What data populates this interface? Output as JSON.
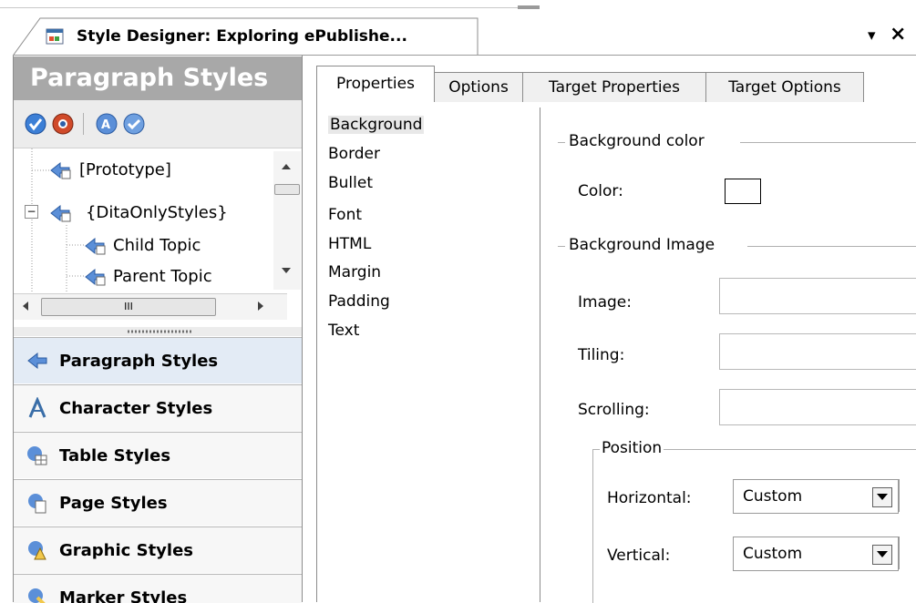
{
  "window": {
    "title": "Style Designer: Exploring ePublishe...",
    "pin_glyph": "▾",
    "close_glyph": "×"
  },
  "left_panel": {
    "header": "Paragraph Styles",
    "toolbar_icons": [
      "check-icon",
      "delete-style-icon",
      "rename-style-icon",
      "apply-style-icon"
    ],
    "tree": [
      {
        "label": "[Prototype]",
        "icon": "paragraph-style-icon"
      },
      {
        "label": "{DitaOnlyStyles}",
        "icon": "paragraph-style-icon",
        "expander": "⊟"
      },
      {
        "label": "Child Topic",
        "icon": "paragraph-style-icon"
      },
      {
        "label": "Parent Topic",
        "icon": "paragraph-style-icon"
      }
    ],
    "hscroll_grip": "III",
    "nav": [
      {
        "label": "Paragraph Styles",
        "icon": "paragraph-styles-icon",
        "selected": true
      },
      {
        "label": "Character Styles",
        "icon": "character-styles-icon"
      },
      {
        "label": "Table Styles",
        "icon": "table-styles-icon"
      },
      {
        "label": "Page Styles",
        "icon": "page-styles-icon"
      },
      {
        "label": "Graphic Styles",
        "icon": "graphic-styles-icon"
      },
      {
        "label": "Marker Styles",
        "icon": "marker-styles-icon"
      }
    ]
  },
  "tabs": [
    "Properties",
    "Options",
    "Target Properties",
    "Target Options"
  ],
  "property_list": [
    "Background",
    "Border",
    "Bullet",
    "Font",
    "HTML",
    "Margin",
    "Padding",
    "Text"
  ],
  "background_color": {
    "group": "Background color",
    "color_label": "Color:",
    "color_value": "#ffffff"
  },
  "background_image": {
    "group": "Background Image",
    "image_label": "Image:",
    "tiling_label": "Tiling:",
    "scrolling_label": "Scrolling:",
    "position_group": "Position",
    "horizontal_label": "Horizontal:",
    "horizontal_value": "Custom",
    "vertical_label": "Vertical:",
    "vertical_value": "Custom"
  }
}
